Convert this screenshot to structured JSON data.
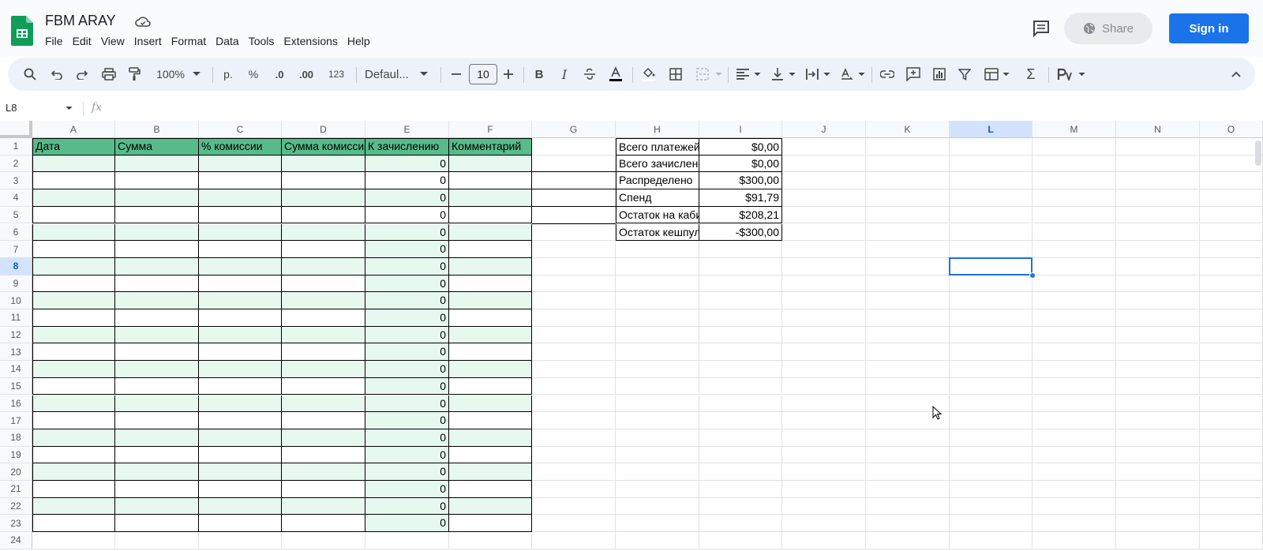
{
  "app": {
    "doc_title": "FBM ARAY",
    "menu": [
      "File",
      "Edit",
      "View",
      "Insert",
      "Format",
      "Data",
      "Tools",
      "Extensions",
      "Help"
    ],
    "share_label": "Share",
    "signin_label": "Sign in"
  },
  "toolbar": {
    "zoom": "100%",
    "currency": "р.",
    "percent": "%",
    "dec_decrease": ".0",
    "dec_increase": ".00",
    "format_123": "123",
    "font": "Defaul...",
    "font_size": "10",
    "bold": "B",
    "italic": "I",
    "sum": "Σ"
  },
  "formula_bar": {
    "name_box": "L8",
    "fx": "fx"
  },
  "sheet": {
    "columns": [
      "A",
      "B",
      "C",
      "D",
      "E",
      "F",
      "G",
      "H",
      "I",
      "J",
      "K",
      "L",
      "M",
      "N",
      "O"
    ],
    "selected_column": "L",
    "selected_row": "8",
    "rows": [
      "1",
      "2",
      "3",
      "4",
      "5",
      "6",
      "7",
      "8",
      "9",
      "10",
      "11",
      "12",
      "13",
      "14",
      "15",
      "16",
      "17",
      "18",
      "19",
      "20",
      "21",
      "22",
      "23",
      "24"
    ],
    "table_headers": [
      "Дата",
      "Сумма",
      "% комиссии",
      "Сумма комисси",
      "К зачислению",
      "Комментарий"
    ],
    "e_values": [
      "0",
      "0",
      "0",
      "0",
      "0",
      "0",
      "0",
      "0",
      "0",
      "0",
      "0",
      "0",
      "0",
      "0",
      "0",
      "0",
      "0",
      "0",
      "0",
      "0",
      "0",
      "0"
    ],
    "summary": [
      {
        "label": "Всего платежей",
        "value": "$0,00"
      },
      {
        "label": "Всего зачислено",
        "value": "$0,00"
      },
      {
        "label": "Распределено",
        "value": "$300,00"
      },
      {
        "label": "Спенд",
        "value": "$91,79"
      },
      {
        "label": "Остаток на кабинетах",
        "value": "$208,21"
      },
      {
        "label": "Остаток кешпул",
        "value": "-$300,00"
      }
    ]
  },
  "colors": {
    "header_green": "#57bb8a",
    "light_green": "#e7f9ef",
    "accent_blue": "#1a73e8"
  }
}
